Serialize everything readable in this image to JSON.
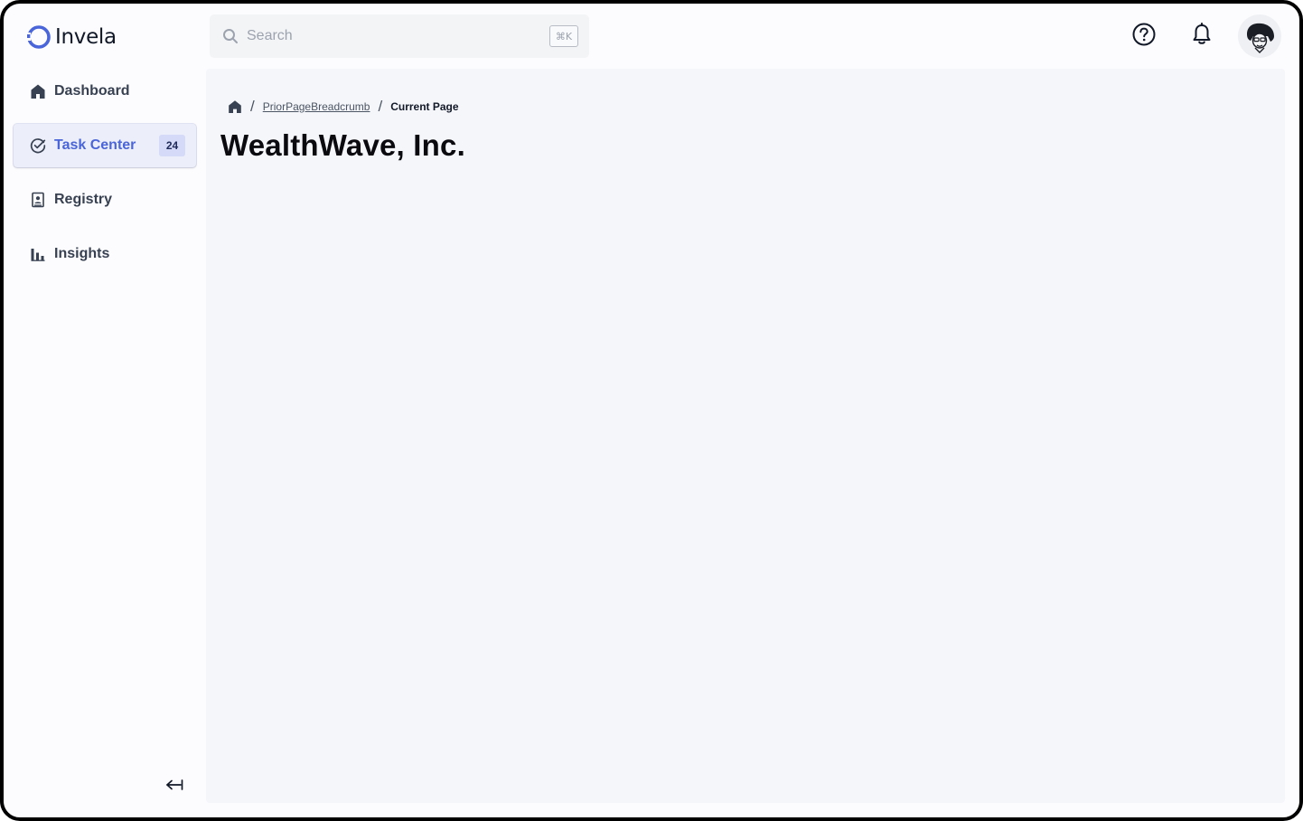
{
  "app": {
    "name": "Invela",
    "brand_color": "#4965d9"
  },
  "search": {
    "placeholder": "Search",
    "shortcut": "⌘K"
  },
  "header": {
    "help_icon": "help-circle-icon",
    "notifications_icon": "bell-icon",
    "avatar": "user-avatar"
  },
  "sidebar": {
    "items": [
      {
        "label": "Dashboard",
        "icon": "home-icon",
        "active": false
      },
      {
        "label": "Task Center",
        "icon": "check-circle-icon",
        "active": true,
        "badge": "24"
      },
      {
        "label": "Registry",
        "icon": "registry-icon",
        "active": false
      },
      {
        "label": "Insights",
        "icon": "bar-chart-icon",
        "active": false
      }
    ],
    "collapse_icon": "collapse-arrow-icon"
  },
  "breadcrumb": {
    "home_icon": "home-icon",
    "prior": "PriorPageBreadcrumb",
    "current": "Current Page"
  },
  "main": {
    "title": "WealthWave, Inc."
  }
}
